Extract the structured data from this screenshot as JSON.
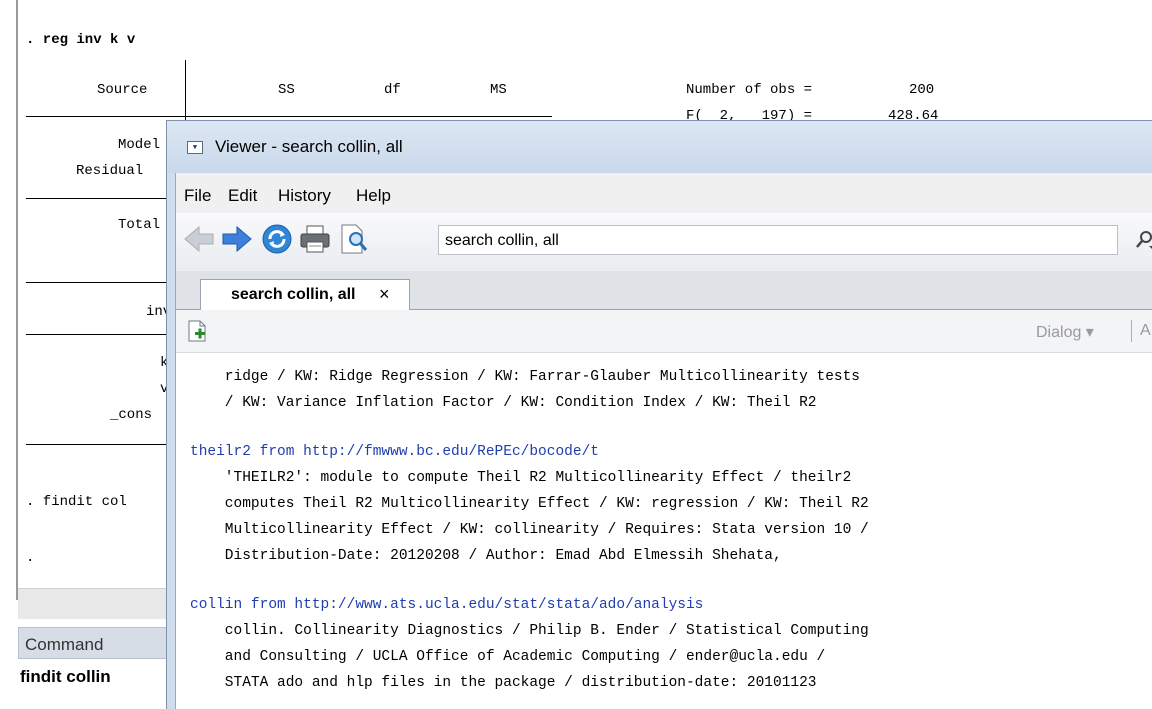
{
  "results": {
    "command_line": ". reg inv k v",
    "header": {
      "source": "Source",
      "ss": "SS",
      "df": "df",
      "ms": "MS"
    },
    "stats": {
      "nobs_label": "Number of obs =",
      "nobs_value": "200",
      "f_label": "F(  2,   197) =",
      "f_value": "428.64"
    },
    "rows": [
      "Model",
      "Residual",
      "Total",
      "inv",
      "k",
      "v",
      "_cons"
    ],
    "findit_cmd": ". findit col",
    "prompt": "."
  },
  "command_panel": {
    "title": "Command",
    "history_item": "findit collin"
  },
  "viewer": {
    "title": "Viewer - search collin, all",
    "menu": [
      "File",
      "Edit",
      "History",
      "Help"
    ],
    "address_value": "search collin, all",
    "tab": {
      "label": "search collin, all",
      "close": "×"
    },
    "dialog_label": "Dialog ▾",
    "dialog_extra": "A",
    "content": [
      {
        "text": "    ridge / KW: Ridge Regression / KW: Farrar-Glauber Multicollinearity tests",
        "type": "text"
      },
      {
        "text": "    / KW: Variance Inflation Factor / KW: Condition Index / KW: Theil R2",
        "type": "text"
      },
      {
        "text": "theilr2 from http://fmwww.bc.edu/RePEc/bocode/t",
        "type": "link"
      },
      {
        "text": "    'THEILR2': module to compute Theil R2 Multicollinearity Effect / theilr2",
        "type": "text"
      },
      {
        "text": "    computes Theil R2 Multicollinearity Effect / KW: regression / KW: Theil R2",
        "type": "text"
      },
      {
        "text": "    Multicollinearity Effect / KW: collinearity / Requires: Stata version 10 /",
        "type": "text"
      },
      {
        "text": "    Distribution-Date: 20120208 / Author: Emad Abd Elmessih Shehata,",
        "type": "text"
      },
      {
        "text": "collin from http://www.ats.ucla.edu/stat/stata/ado/analysis",
        "type": "link"
      },
      {
        "text": "    collin. Collinearity Diagnostics / Philip B. Ender / Statistical Computing",
        "type": "text"
      },
      {
        "text": "    and Consulting / UCLA Office of Academic Computing / ender@ucla.edu /",
        "type": "text"
      },
      {
        "text": "    STATA ado and hlp files in the package / distribution-date: 20101123",
        "type": "text"
      }
    ]
  },
  "colors": {
    "link": "#1f3fae",
    "viewer_frame": "#cfdcec"
  }
}
